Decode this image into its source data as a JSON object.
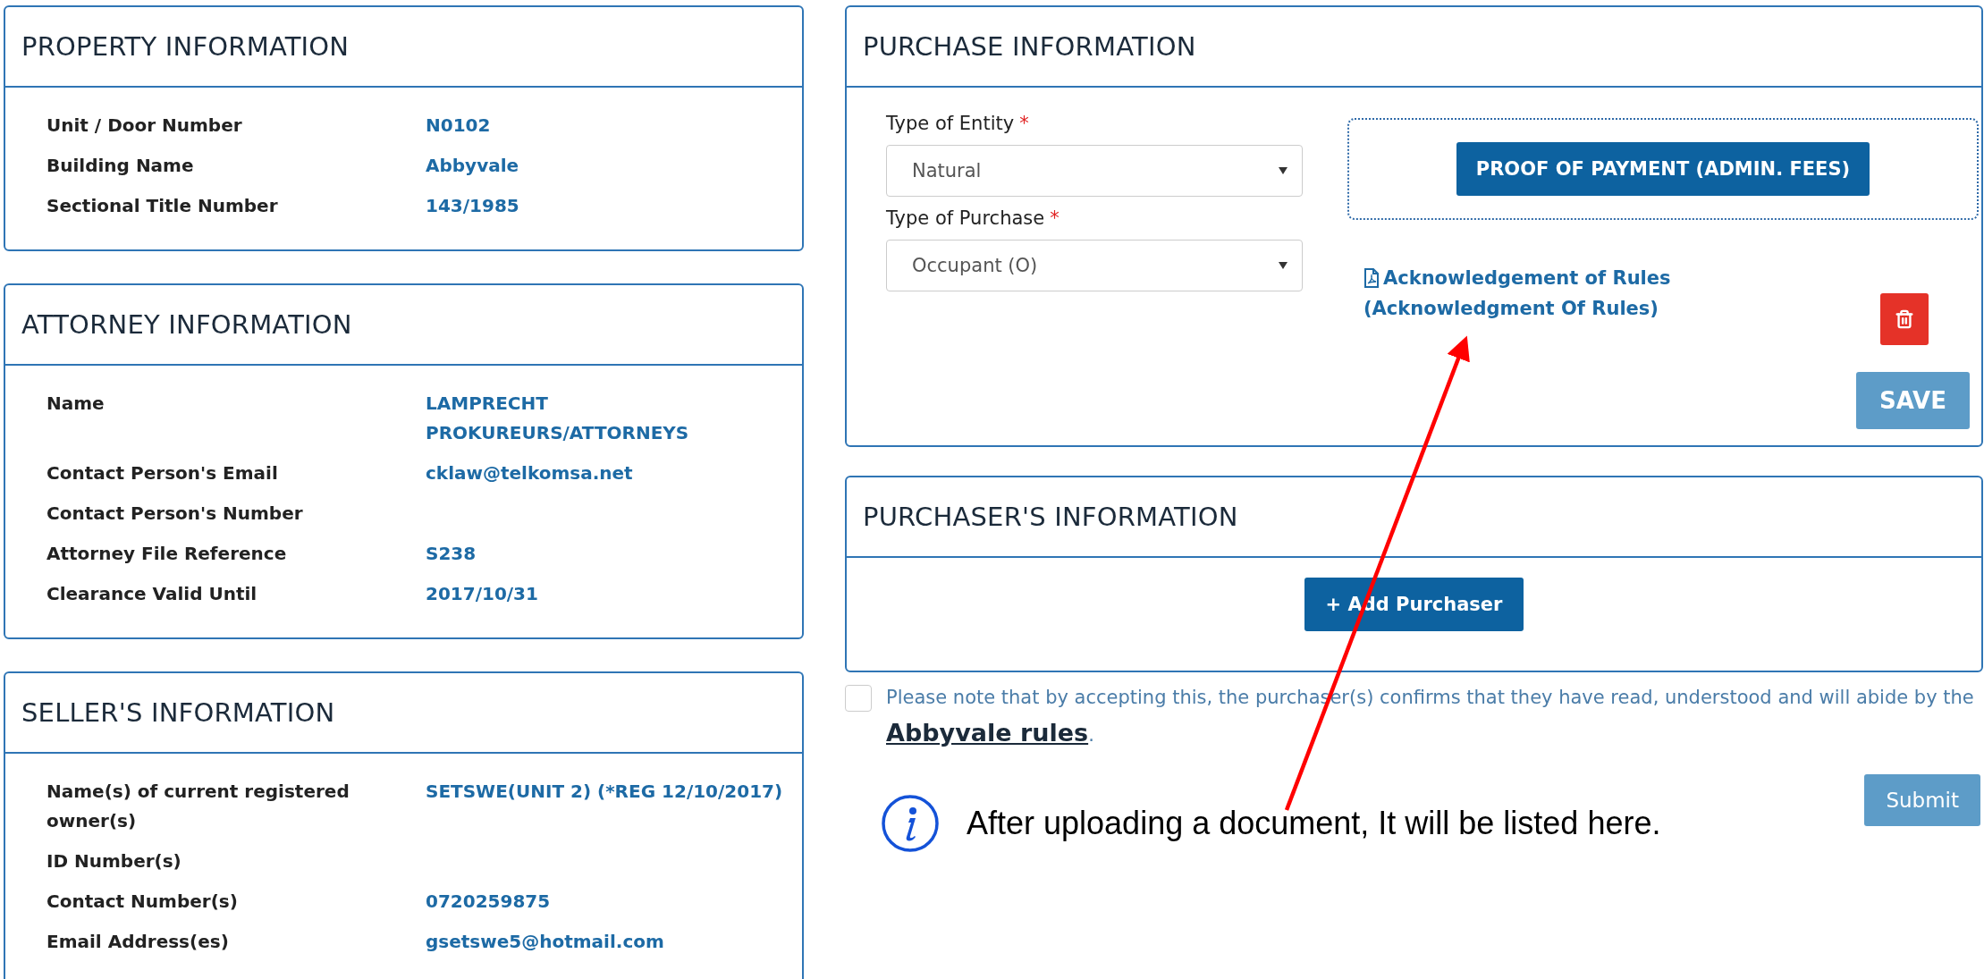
{
  "property": {
    "title": "PROPERTY INFORMATION",
    "rows": [
      {
        "label": "Unit / Door Number",
        "value": "N0102"
      },
      {
        "label": "Building Name",
        "value": "Abbyvale"
      },
      {
        "label": "Sectional Title Number",
        "value": "143/1985"
      }
    ]
  },
  "attorney": {
    "title": "ATTORNEY INFORMATION",
    "rows": [
      {
        "label": "Name",
        "value": "LAMPRECHT PROKUREURS/ATTORNEYS"
      },
      {
        "label": "Contact Person's Email",
        "value": "cklaw@telkomsa.net"
      },
      {
        "label": "Contact Person's Number"
      },
      {
        "label": "Attorney File Reference",
        "value": "S238"
      },
      {
        "label": "Clearance Valid Until",
        "value": "2017/10/31"
      }
    ]
  },
  "seller": {
    "title": "SELLER'S INFORMATION",
    "rows": [
      {
        "label": "Name(s) of current registered owner(s)",
        "value": "SETSWE(UNIT 2) (*REG 12/10/2017)"
      },
      {
        "label": "ID Number(s)"
      },
      {
        "label": "Contact Number(s)",
        "value": "0720259875"
      },
      {
        "label": "Email Address(es)",
        "value": "gsetswe5@hotmail.com"
      }
    ]
  },
  "purchase": {
    "title": "PURCHASE INFORMATION",
    "fields": [
      {
        "label": "Type of Entity",
        "required_mark": "*",
        "value": "Natural"
      },
      {
        "label": "Type of Purchase",
        "required_mark": "*",
        "value": "Occupant (O)"
      }
    ],
    "proof_button": "PROOF OF PAYMENT (ADMIN. FEES)",
    "document": {
      "title": "Acknowledgement of Rules",
      "subtitle": "(Acknowledgment Of Rules)"
    },
    "save_button": "SAVE"
  },
  "purchasers": {
    "title": "PURCHASER'S INFORMATION",
    "add_button": "+ Add Purchaser"
  },
  "consent": {
    "checked": false,
    "text": "Please note that by accepting this, the purchaser(s) confirms that they have read, understood and will abide by the",
    "link": "Abbyvale rules",
    "end": "."
  },
  "annotation": {
    "text": "After uploading a document, It will be listed here."
  },
  "submit_button": "Submit"
}
